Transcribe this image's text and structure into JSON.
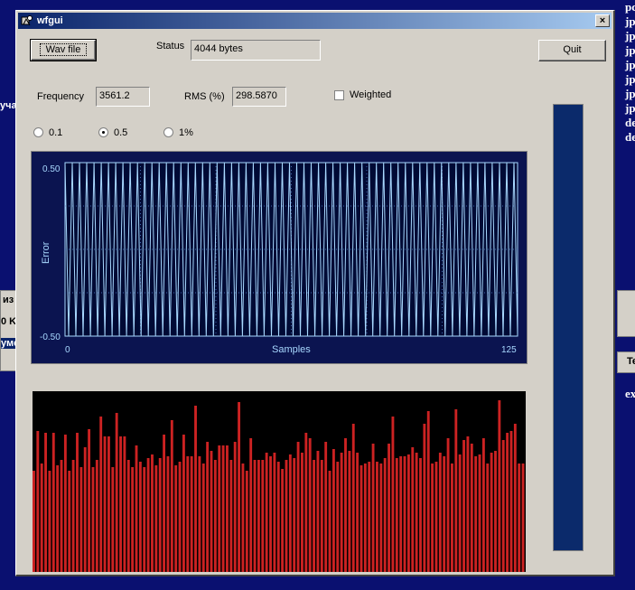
{
  "desktop": {
    "right_items": [
      "pc",
      "jp",
      "jp",
      "jp",
      "jp",
      "jp",
      "jp",
      "jp",
      "de",
      "de"
    ],
    "left_text": "уча",
    "frag_1": "из",
    "frag_2": "0 K",
    "frag_3": "уме",
    "frag_4": "Te",
    "frag_5": "ex"
  },
  "window": {
    "title": "wfgui",
    "close_glyph": "×"
  },
  "toolbar": {
    "wav_button": "Wav file",
    "status_label": "Status",
    "status_value": "4044 bytes",
    "quit_button": "Quit"
  },
  "measure": {
    "frequency_label": "Frequency",
    "frequency_value": "3561.2",
    "rms_label": "RMS (%)",
    "rms_value": "298.5870",
    "weighted_label": "Weighted",
    "weighted_checked": false
  },
  "radios": [
    {
      "label": "0.1",
      "checked": false
    },
    {
      "label": "0.5",
      "checked": true
    },
    {
      "label": "1%",
      "checked": false
    }
  ],
  "colors": {
    "plot_bg": "#0b1450",
    "plot_line": "#a8d8ff",
    "bar_red": "#cc2222",
    "meter": "#0b2a6b"
  },
  "chart_data": [
    {
      "type": "line",
      "title": "",
      "xlabel": "Samples",
      "ylabel": "Error",
      "xlim": [
        0,
        125
      ],
      "ylim": [
        -0.5,
        0.5
      ],
      "xticks": [
        "0",
        "125"
      ],
      "yticks": [
        "0.50",
        "-0.50"
      ],
      "grid": true,
      "note_values": "signal oscillates between -0.50 and 0.50 on every sample",
      "series": [
        {
          "values": [
            0.5,
            -0.5,
            0.5,
            -0.5,
            0.5,
            -0.5,
            0.5,
            -0.5,
            0.5,
            -0.5,
            0.5,
            -0.5,
            0.5,
            -0.5,
            0.5,
            -0.5,
            0.5,
            -0.5,
            0.5,
            -0.5,
            0.5,
            -0.5,
            0.5,
            -0.5,
            0.5,
            -0.5,
            0.5,
            -0.5,
            0.5,
            -0.5,
            0.5,
            -0.5,
            0.5,
            -0.5,
            0.5,
            -0.5,
            0.5,
            -0.5,
            0.5,
            -0.5,
            0.5,
            -0.5,
            0.5,
            -0.5,
            0.5,
            -0.5,
            0.5,
            -0.5,
            0.5,
            -0.5,
            0.5,
            -0.5,
            0.5,
            -0.5,
            0.5,
            -0.5,
            0.5,
            -0.5,
            0.5,
            -0.5,
            0.5,
            -0.5,
            0.5,
            -0.5,
            0.5,
            -0.5,
            0.5,
            -0.5,
            0.5,
            -0.5,
            0.5,
            -0.5,
            0.5,
            -0.5,
            0.5,
            -0.5,
            0.5,
            -0.5,
            0.5,
            -0.5,
            0.5,
            -0.5,
            0.5,
            -0.5,
            0.5,
            -0.5,
            0.5,
            -0.5,
            0.5,
            -0.5,
            0.5,
            -0.5,
            0.5,
            -0.5,
            0.5,
            -0.5,
            0.5,
            -0.5,
            0.5,
            -0.5,
            0.5,
            -0.5,
            0.5,
            -0.5,
            0.5,
            -0.5,
            0.5,
            -0.5,
            0.5,
            -0.5,
            0.5,
            -0.5,
            0.5,
            -0.5,
            0.5,
            -0.5,
            0.5,
            -0.5,
            0.5,
            -0.5,
            0.5,
            -0.5,
            0.5,
            -0.5,
            0.5,
            -0.5
          ]
        }
      ]
    },
    {
      "type": "bar",
      "title": "",
      "ylim": [
        0,
        1
      ],
      "values": [
        0.56,
        0.78,
        0.6,
        0.77,
        0.56,
        0.77,
        0.59,
        0.62,
        0.76,
        0.56,
        0.62,
        0.77,
        0.58,
        0.69,
        0.79,
        0.58,
        0.62,
        0.86,
        0.75,
        0.75,
        0.58,
        0.88,
        0.75,
        0.75,
        0.62,
        0.58,
        0.7,
        0.61,
        0.58,
        0.63,
        0.65,
        0.59,
        0.63,
        0.76,
        0.64,
        0.84,
        0.59,
        0.61,
        0.76,
        0.64,
        0.64,
        0.92,
        0.64,
        0.6,
        0.72,
        0.67,
        0.62,
        0.7,
        0.7,
        0.7,
        0.62,
        0.72,
        0.94,
        0.6,
        0.56,
        0.74,
        0.62,
        0.62,
        0.62,
        0.66,
        0.64,
        0.66,
        0.61,
        0.57,
        0.62,
        0.65,
        0.63,
        0.72,
        0.66,
        0.77,
        0.74,
        0.62,
        0.67,
        0.62,
        0.72,
        0.56,
        0.68,
        0.61,
        0.66,
        0.74,
        0.67,
        0.82,
        0.66,
        0.59,
        0.6,
        0.61,
        0.71,
        0.61,
        0.6,
        0.63,
        0.71,
        0.86,
        0.63,
        0.64,
        0.64,
        0.65,
        0.69,
        0.66,
        0.63,
        0.82,
        0.89,
        0.6,
        0.61,
        0.66,
        0.64,
        0.74,
        0.6,
        0.9,
        0.65,
        0.73,
        0.75,
        0.71,
        0.64,
        0.65,
        0.74,
        0.6,
        0.66,
        0.67,
        0.95,
        0.73,
        0.77,
        0.78,
        0.82,
        0.6,
        0.6
      ]
    }
  ]
}
